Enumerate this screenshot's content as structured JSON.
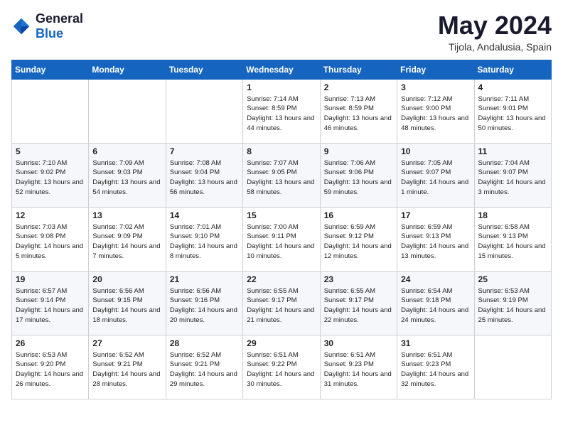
{
  "logo": {
    "text_general": "General",
    "text_blue": "Blue"
  },
  "title": "May 2024",
  "location": "Tijola, Andalusia, Spain",
  "weekdays": [
    "Sunday",
    "Monday",
    "Tuesday",
    "Wednesday",
    "Thursday",
    "Friday",
    "Saturday"
  ],
  "weeks": [
    [
      {
        "day": "",
        "info": ""
      },
      {
        "day": "",
        "info": ""
      },
      {
        "day": "",
        "info": ""
      },
      {
        "day": "1",
        "info": "Sunrise: 7:14 AM\nSunset: 8:59 PM\nDaylight: 13 hours\nand 44 minutes."
      },
      {
        "day": "2",
        "info": "Sunrise: 7:13 AM\nSunset: 8:59 PM\nDaylight: 13 hours\nand 46 minutes."
      },
      {
        "day": "3",
        "info": "Sunrise: 7:12 AM\nSunset: 9:00 PM\nDaylight: 13 hours\nand 48 minutes."
      },
      {
        "day": "4",
        "info": "Sunrise: 7:11 AM\nSunset: 9:01 PM\nDaylight: 13 hours\nand 50 minutes."
      }
    ],
    [
      {
        "day": "5",
        "info": "Sunrise: 7:10 AM\nSunset: 9:02 PM\nDaylight: 13 hours\nand 52 minutes."
      },
      {
        "day": "6",
        "info": "Sunrise: 7:09 AM\nSunset: 9:03 PM\nDaylight: 13 hours\nand 54 minutes."
      },
      {
        "day": "7",
        "info": "Sunrise: 7:08 AM\nSunset: 9:04 PM\nDaylight: 13 hours\nand 56 minutes."
      },
      {
        "day": "8",
        "info": "Sunrise: 7:07 AM\nSunset: 9:05 PM\nDaylight: 13 hours\nand 58 minutes."
      },
      {
        "day": "9",
        "info": "Sunrise: 7:06 AM\nSunset: 9:06 PM\nDaylight: 13 hours\nand 59 minutes."
      },
      {
        "day": "10",
        "info": "Sunrise: 7:05 AM\nSunset: 9:07 PM\nDaylight: 14 hours\nand 1 minute."
      },
      {
        "day": "11",
        "info": "Sunrise: 7:04 AM\nSunset: 9:07 PM\nDaylight: 14 hours\nand 3 minutes."
      }
    ],
    [
      {
        "day": "12",
        "info": "Sunrise: 7:03 AM\nSunset: 9:08 PM\nDaylight: 14 hours\nand 5 minutes."
      },
      {
        "day": "13",
        "info": "Sunrise: 7:02 AM\nSunset: 9:09 PM\nDaylight: 14 hours\nand 7 minutes."
      },
      {
        "day": "14",
        "info": "Sunrise: 7:01 AM\nSunset: 9:10 PM\nDaylight: 14 hours\nand 8 minutes."
      },
      {
        "day": "15",
        "info": "Sunrise: 7:00 AM\nSunset: 9:11 PM\nDaylight: 14 hours\nand 10 minutes."
      },
      {
        "day": "16",
        "info": "Sunrise: 6:59 AM\nSunset: 9:12 PM\nDaylight: 14 hours\nand 12 minutes."
      },
      {
        "day": "17",
        "info": "Sunrise: 6:59 AM\nSunset: 9:13 PM\nDaylight: 14 hours\nand 13 minutes."
      },
      {
        "day": "18",
        "info": "Sunrise: 6:58 AM\nSunset: 9:13 PM\nDaylight: 14 hours\nand 15 minutes."
      }
    ],
    [
      {
        "day": "19",
        "info": "Sunrise: 6:57 AM\nSunset: 9:14 PM\nDaylight: 14 hours\nand 17 minutes."
      },
      {
        "day": "20",
        "info": "Sunrise: 6:56 AM\nSunset: 9:15 PM\nDaylight: 14 hours\nand 18 minutes."
      },
      {
        "day": "21",
        "info": "Sunrise: 6:56 AM\nSunset: 9:16 PM\nDaylight: 14 hours\nand 20 minutes."
      },
      {
        "day": "22",
        "info": "Sunrise: 6:55 AM\nSunset: 9:17 PM\nDaylight: 14 hours\nand 21 minutes."
      },
      {
        "day": "23",
        "info": "Sunrise: 6:55 AM\nSunset: 9:17 PM\nDaylight: 14 hours\nand 22 minutes."
      },
      {
        "day": "24",
        "info": "Sunrise: 6:54 AM\nSunset: 9:18 PM\nDaylight: 14 hours\nand 24 minutes."
      },
      {
        "day": "25",
        "info": "Sunrise: 6:53 AM\nSunset: 9:19 PM\nDaylight: 14 hours\nand 25 minutes."
      }
    ],
    [
      {
        "day": "26",
        "info": "Sunrise: 6:53 AM\nSunset: 9:20 PM\nDaylight: 14 hours\nand 26 minutes."
      },
      {
        "day": "27",
        "info": "Sunrise: 6:52 AM\nSunset: 9:21 PM\nDaylight: 14 hours\nand 28 minutes."
      },
      {
        "day": "28",
        "info": "Sunrise: 6:52 AM\nSunset: 9:21 PM\nDaylight: 14 hours\nand 29 minutes."
      },
      {
        "day": "29",
        "info": "Sunrise: 6:51 AM\nSunset: 9:22 PM\nDaylight: 14 hours\nand 30 minutes."
      },
      {
        "day": "30",
        "info": "Sunrise: 6:51 AM\nSunset: 9:23 PM\nDaylight: 14 hours\nand 31 minutes."
      },
      {
        "day": "31",
        "info": "Sunrise: 6:51 AM\nSunset: 9:23 PM\nDaylight: 14 hours\nand 32 minutes."
      },
      {
        "day": "",
        "info": ""
      }
    ]
  ]
}
